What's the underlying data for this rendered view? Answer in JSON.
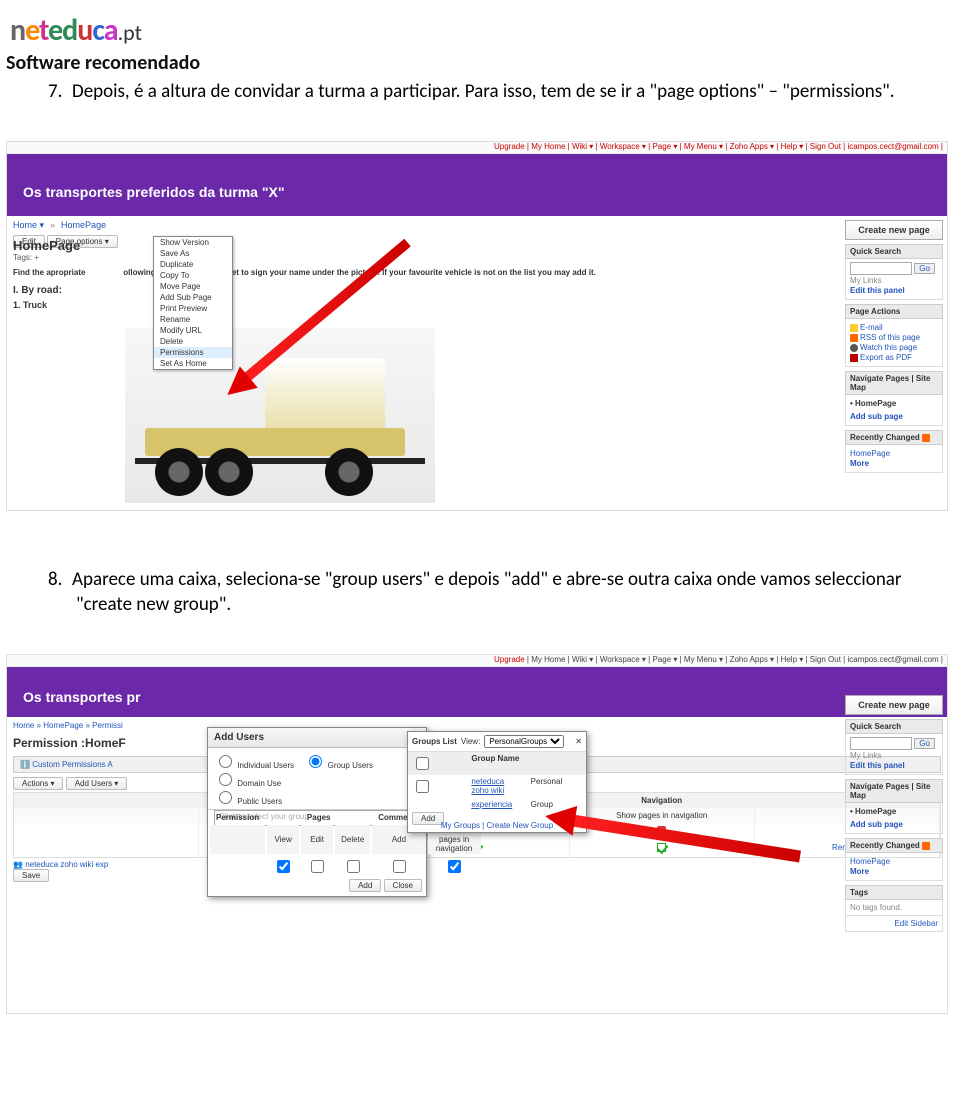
{
  "logo_pt": ".pt",
  "doc_subtitle": "Software recomendado",
  "steps": {
    "s7_num": "7.",
    "s7_text": "Depois, é a altura de convidar a turma a participar. Para isso, tem de se ir a \"page options\" – \"permissions\".",
    "s8_num": "8.",
    "s8_text": "Aparece uma caixa, seleciona-se \"group users\" e depois \"add\" e abre-se outra caixa onde vamos seleccionar \"create new group\"."
  },
  "ss1": {
    "topnav": "Upgrade | My Home | Wiki ▾ | Workspace ▾ | Page ▾ | My Menu ▾ | Zoho Apps ▾ | Help ▾ | Sign Out | icampos.cect@gmail.com |",
    "wiki_title": "Os transportes preferidos da turma \"X\"",
    "breadcrumb_home": "Home ▾",
    "breadcrumb_hp": "HomePage",
    "btn_edit": "Edit",
    "btn_page_opts": "Page options ▾",
    "home_h": "HomePage",
    "tags": "Tags: +",
    "apropriate": "Find the apropriate",
    "apropriate_tail": "ollowing vehicles. Don't forget to sign your name under the picture. If your favourite vehicle is not on the list you may add it.",
    "byroad": "I. By road:",
    "truck": "1. Truck",
    "dropdown": [
      "Show Version",
      "Save As",
      "Duplicate",
      "Copy To",
      "Move Page",
      "Add Sub Page",
      "Print Preview",
      "Rename",
      "Modify URL",
      "Delete",
      "Permissions",
      "Set As Home"
    ],
    "right": {
      "create": "Create new page",
      "qs_h": "Quick Search",
      "go": "Go",
      "mylinks": "My Links",
      "editpanel": "Edit this panel",
      "pa_h": "Page Actions",
      "pa": [
        "E-mail",
        "RSS of this page",
        "Watch this page",
        "Export as PDF"
      ],
      "nav_h": "Navigate Pages | Site Map",
      "nav_hp": "HomePage",
      "nav_add": "Add sub page",
      "rc_h": "Recently Changed",
      "rc_hp": "HomePage",
      "rc_more": "More"
    }
  },
  "ss2": {
    "topnav": "Upgrade | My Home | Wiki ▾ | Workspace ▾ | Page ▾ | My Menu ▾ | Zoho Apps ▾ | Help ▾ | Sign Out | icampos.cect@gmail.com |",
    "wiki_title_short": "Os transportes pr",
    "crumb": "Home » HomePage » Permissi",
    "perm_h": "Permission :HomeF",
    "custom_bar": "Custom Permissions A",
    "actions": "Actions ▾",
    "addusers": "Add Users ▾",
    "save": "Save",
    "exp_row": "neteduca zoho wiki exp",
    "table": {
      "h": [
        "",
        "Pages",
        "",
        "Comments",
        "Navigation"
      ],
      "sub": [
        "Permission",
        "View",
        "Edit",
        "Delete",
        "Add",
        "Show pages in navigation"
      ],
      "cols2": [
        "",
        "Comments",
        "",
        "Navigation",
        ""
      ],
      "sub2": [
        "",
        "Delete",
        "Add",
        "Show pages in navigation",
        ""
      ],
      "remove": "Remove"
    },
    "modal1": {
      "title": "Add Users",
      "r1": [
        "Individual Users",
        "Group Users",
        "Domain Use"
      ],
      "r2": "Public Users",
      "placeholder": "Click to select your group",
      "perm_head": [
        "Permission",
        "Pages",
        "Comments",
        "Navigation"
      ],
      "perm_sub": [
        "",
        "View",
        "Edit",
        "Delete",
        "Add",
        "Show pages in navigation"
      ],
      "btn_add": "Add",
      "btn_close": "Close"
    },
    "modal2": {
      "glist": "Groups List",
      "view": "View:",
      "view_val": "PersonalGroups",
      "gh": [
        "",
        "Group Name",
        ""
      ],
      "rows": [
        {
          "n": "neteduca zoho wiki",
          "t": "Personal"
        },
        {
          "n": "experiencia",
          "t": "Group"
        }
      ],
      "btn_add": "Add",
      "footer": "My Groups | Create New Group"
    },
    "right": {
      "create": "Create new page",
      "qs_h": "Quick Search",
      "go": "Go",
      "mylinks": "My Links",
      "editpanel": "Edit this panel",
      "nav_h": "Navigate Pages | Site Map",
      "nav_hp": "HomePage",
      "nav_add": "Add sub page",
      "rc_h": "Recently Changed",
      "rc_hp": "HomePage",
      "rc_more": "More",
      "tags_h": "Tags",
      "tags_none": "No tags found.",
      "edit_sidebar": "Edit Sidebar"
    }
  }
}
